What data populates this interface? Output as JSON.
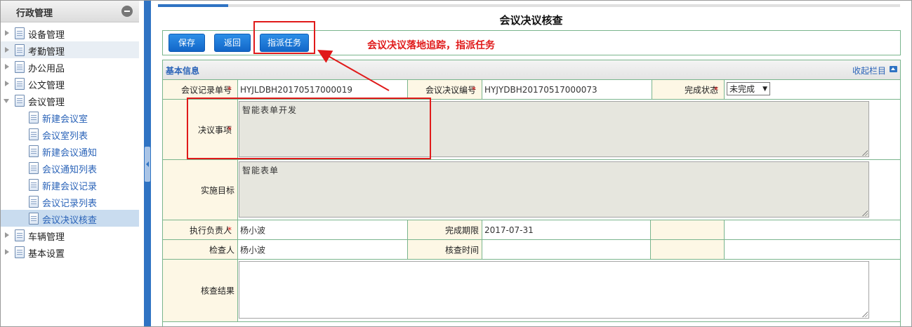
{
  "sidebar": {
    "title": "行政管理",
    "items": [
      {
        "label": "设备管理"
      },
      {
        "label": "考勤管理"
      },
      {
        "label": "办公用品"
      },
      {
        "label": "公文管理"
      },
      {
        "label": "会议管理"
      },
      {
        "label": "新建会议室"
      },
      {
        "label": "会议室列表"
      },
      {
        "label": "新建会议通知"
      },
      {
        "label": "会议通知列表"
      },
      {
        "label": "新建会议记录"
      },
      {
        "label": "会议记录列表"
      },
      {
        "label": "会议决议核查"
      },
      {
        "label": "车辆管理"
      },
      {
        "label": "基本设置"
      }
    ]
  },
  "page": {
    "title": "会议决议核查",
    "toolbar": {
      "save_label": "保存",
      "back_label": "返回",
      "assign_label": "指派任务",
      "annotation": "会议决议落地追踪，指派任务"
    },
    "section": {
      "title": "基本信息",
      "collapse_label": "收起栏目"
    },
    "form": {
      "record_no_label": "会议记录单号",
      "record_no_value": "HYJLDBH20170517000019",
      "resolution_no_label": "会议决议编号",
      "resolution_no_value": "HYJYDBH20170517000073",
      "status_label": "完成状态",
      "status_value": "未完成",
      "matter_label": "决议事项",
      "matter_value": "智能表单开发",
      "goal_label": "实施目标",
      "goal_value": "智能表单",
      "owner_label": "执行负责人",
      "owner_value": "杨小波",
      "deadline_label": "完成期限",
      "deadline_value": "2017-07-31",
      "checker_label": "检查人",
      "checker_value": "杨小波",
      "check_time_label": "核查时间",
      "check_time_value": "",
      "result_label": "核查结果",
      "result_value": "",
      "required_mark": "*"
    }
  },
  "colors": {
    "accent": "#2f73c3",
    "annotation": "#e01a1a",
    "border": "#7ab58d",
    "label_bg": "#fdf7e5"
  }
}
